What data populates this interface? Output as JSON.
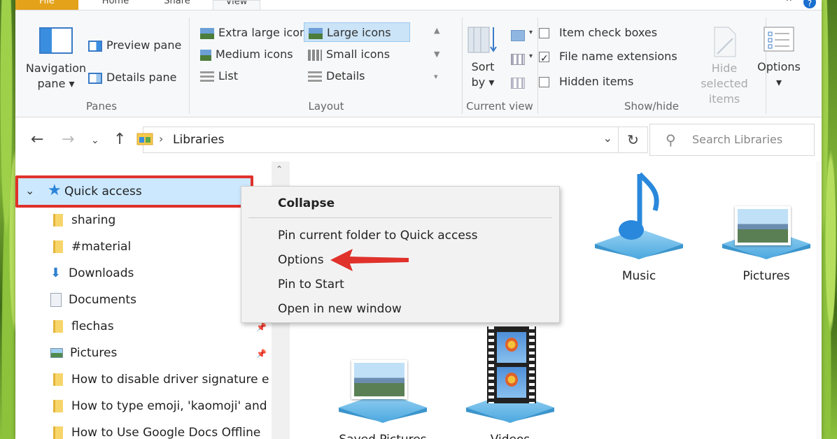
{
  "tabs": {
    "file": "File",
    "home": "Home",
    "share": "Share",
    "view": "View"
  },
  "ribbon": {
    "panes": {
      "navigation_pane_line1": "Navigation",
      "navigation_pane_line2": "pane ▾",
      "preview_pane": "Preview pane",
      "details_pane": "Details pane",
      "label": "Panes"
    },
    "layout": {
      "items": [
        {
          "label": "Extra large icons",
          "active": false
        },
        {
          "label": "Large icons",
          "active": true
        },
        {
          "label": "Medium icons",
          "active": false
        },
        {
          "label": "Small icons",
          "active": false
        },
        {
          "label": "List",
          "active": false
        },
        {
          "label": "Details",
          "active": false
        }
      ],
      "label": "Layout"
    },
    "current_view": {
      "sort_line1": "Sort",
      "sort_line2": "by ▾",
      "label": "Current view"
    },
    "show_hide": {
      "item_check_boxes": "Item check boxes",
      "file_name_extensions": "File name extensions",
      "hidden_items": "Hidden items",
      "item_check_boxes_checked": false,
      "file_name_extensions_checked": true,
      "hidden_items_checked": false,
      "hide_selected_line1": "Hide selected",
      "hide_selected_line2": "items",
      "label": "Show/hide"
    },
    "options": {
      "label": "Options",
      "arrow": "▾"
    }
  },
  "address": {
    "path": "Libraries",
    "search_placeholder": "Search Libraries"
  },
  "nav_pane": {
    "quick_access": "Quick access",
    "items": [
      {
        "label": "sharing",
        "icon": "folder-icon"
      },
      {
        "label": "#material",
        "icon": "folder-icon"
      },
      {
        "label": "Downloads",
        "icon": "download-icon"
      },
      {
        "label": "Documents",
        "icon": "document-icon"
      },
      {
        "label": "flechas",
        "icon": "folder-icon"
      },
      {
        "label": "Pictures",
        "icon": "pictures-icon"
      },
      {
        "label": "How to disable driver signature er",
        "icon": "folder-icon"
      },
      {
        "label": "How to type emoji, 'kaomoji' and",
        "icon": "folder-icon"
      },
      {
        "label": "How to Use Google Docs Offline",
        "icon": "folder-icon"
      }
    ]
  },
  "context_menu": {
    "collapse": "Collapse",
    "pin_quick_access": "Pin current folder to Quick access",
    "options": "Options",
    "pin_start": "Pin to Start",
    "open_new_window": "Open in new window"
  },
  "libraries": {
    "music": "Music",
    "pictures": "Pictures",
    "saved_pictures": "Saved Pictures",
    "videos": "Videos"
  },
  "colors": {
    "accent_file_tab": "#e3a21a",
    "selection": "#cce8ff",
    "highlight_border": "#e0312b",
    "arrow": "#e0312b"
  }
}
